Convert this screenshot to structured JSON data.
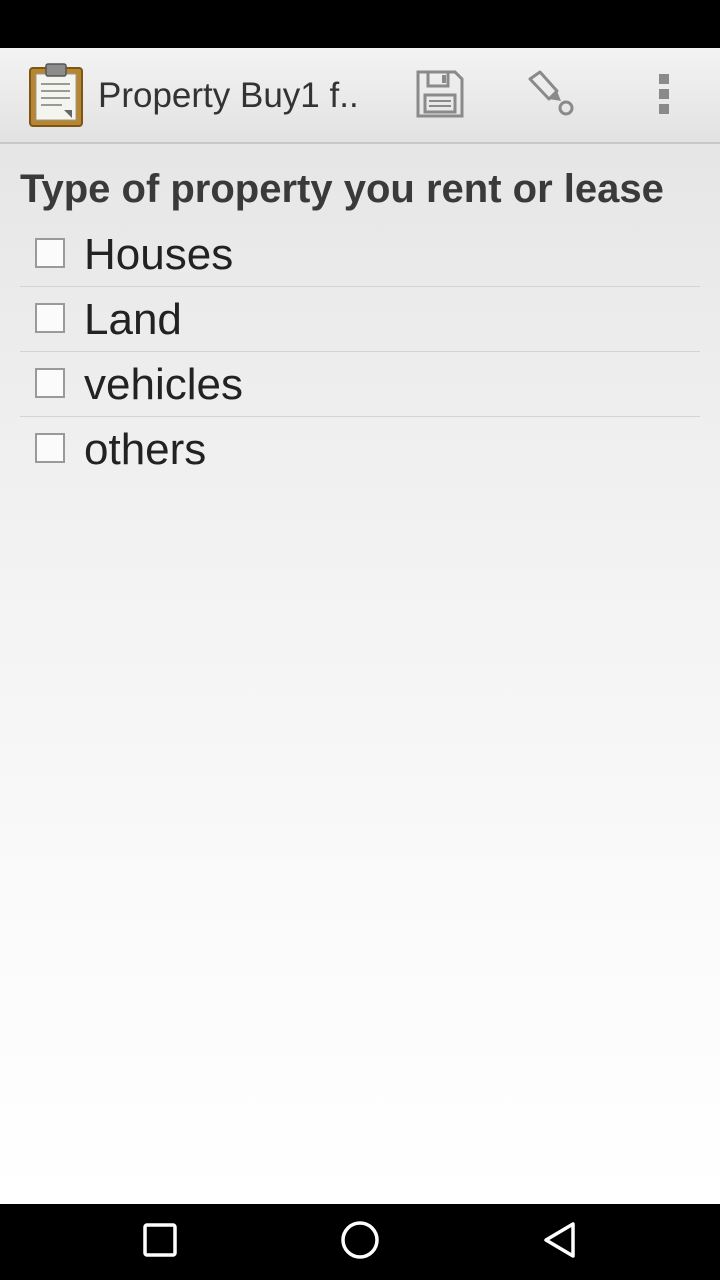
{
  "app": {
    "title": "Property Buy1 f.."
  },
  "action_bar": {
    "icons": [
      "clipboard-icon",
      "save-icon",
      "eraser-icon",
      "overflow-menu-icon"
    ]
  },
  "form": {
    "question": "Type of property you rent or lease",
    "options": [
      {
        "label": "Houses",
        "checked": false
      },
      {
        "label": "Land",
        "checked": false
      },
      {
        "label": "vehicles",
        "checked": false
      },
      {
        "label": "others",
        "checked": false
      }
    ]
  },
  "navigation": {
    "icons": [
      "recents-icon",
      "home-icon",
      "back-icon"
    ]
  },
  "colors": {
    "status_bar": "#000000",
    "action_bar": "#eeeeee",
    "title_text": "#333333",
    "nav_bar": "#000000",
    "nav_icon": "#ffffff"
  }
}
